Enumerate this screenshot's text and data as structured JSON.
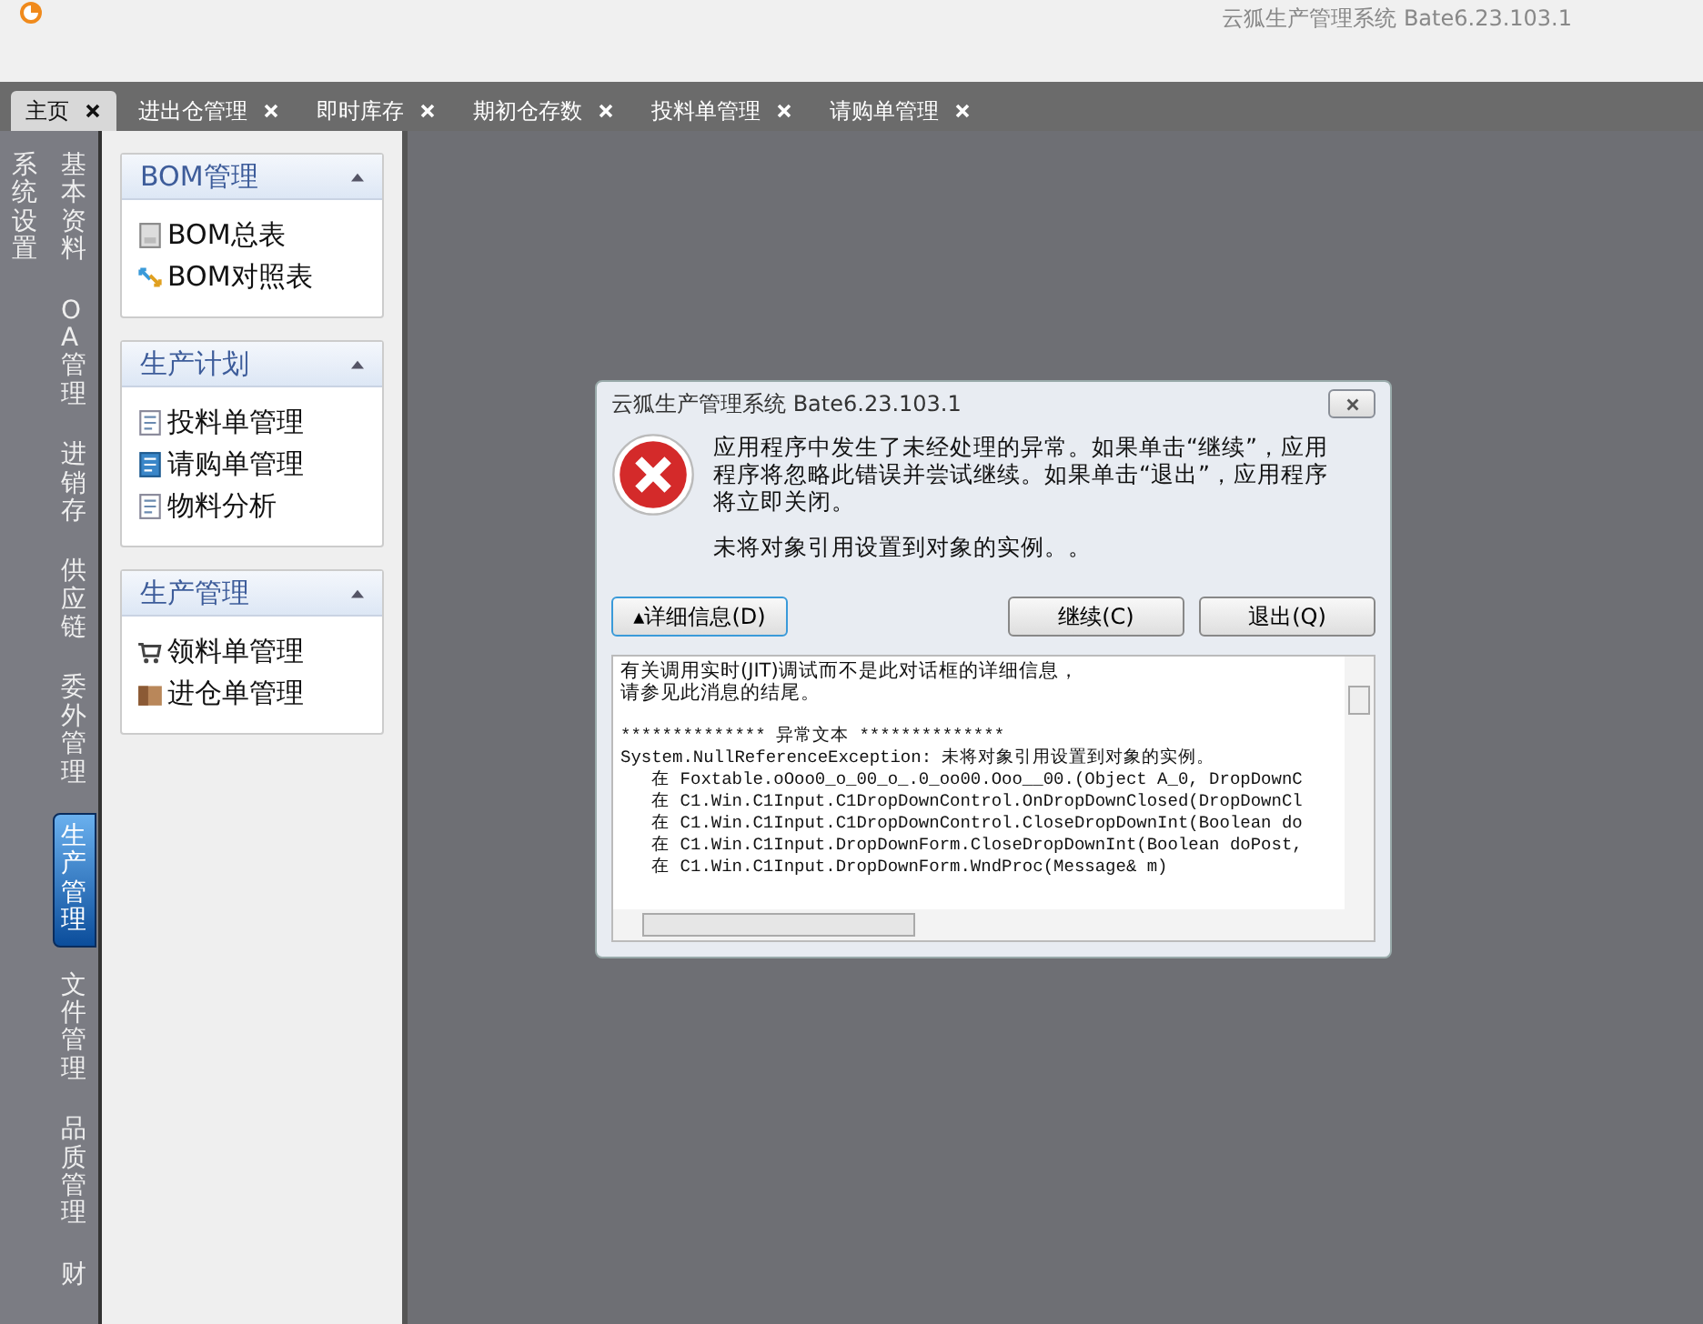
{
  "app_title": "云狐生产管理系统 Bate6.23.103.1",
  "tabs": [
    {
      "label": "主页",
      "selected": true
    },
    {
      "label": "进出仓管理",
      "selected": false
    },
    {
      "label": "即时库存",
      "selected": false
    },
    {
      "label": "期初仓存数",
      "selected": false
    },
    {
      "label": "投料单管理",
      "selected": false
    },
    {
      "label": "请购单管理",
      "selected": false
    }
  ],
  "nav_columns": [
    [
      {
        "label": "系统设置",
        "selected": false
      }
    ],
    [
      {
        "label": "基本资料",
        "selected": false
      },
      {
        "label": "OA管理",
        "selected": false
      },
      {
        "label": "进销存",
        "selected": false
      },
      {
        "label": "供应链",
        "selected": false
      },
      {
        "label": "委外管理",
        "selected": false
      },
      {
        "label": "生产管理",
        "selected": true
      },
      {
        "label": "文件管理",
        "selected": false
      },
      {
        "label": "品质管理",
        "selected": false
      },
      {
        "label": "财",
        "selected": false
      }
    ]
  ],
  "groups": [
    {
      "title": "BOM管理",
      "expanded": true,
      "items": [
        {
          "label": "BOM总表",
          "kind": "sheet"
        },
        {
          "label": "BOM对照表",
          "kind": "swap"
        }
      ]
    },
    {
      "title": "生产计划",
      "expanded": true,
      "items": [
        {
          "label": "投料单管理",
          "kind": "doc"
        },
        {
          "label": "请购单管理",
          "kind": "bluedoc"
        },
        {
          "label": "物料分析",
          "kind": "doc"
        }
      ]
    },
    {
      "title": "生产管理",
      "expanded": true,
      "items": [
        {
          "label": "领料单管理",
          "kind": "cart"
        },
        {
          "label": "进仓单管理",
          "kind": "box"
        }
      ]
    }
  ],
  "dialog": {
    "title": "云狐生产管理系统 Bate6.23.103.1",
    "message": "应用程序中发生了未经处理的异常。如果单击“继续”，应用程序将忽略此错误并尝试继续。如果单击“退出”，应用程序将立即关闭。",
    "detail_message": "未将对象引用设置到对象的实例。。",
    "details_button": "▴详细信息(D)",
    "buttons": [
      "继续(C)",
      "退出(Q)"
    ],
    "details": [
      {
        "kind": "note",
        "text": "有关调用实时(JIT)调试而不是此对话框的详细信息，"
      },
      {
        "kind": "note",
        "text": "请参见此消息的结尾。"
      },
      {
        "kind": "heading",
        "text": "************** 异常文本 **************"
      },
      {
        "kind": "trace",
        "text": "System.NullReferenceException: 未将对象引用设置到对象的实例。"
      },
      {
        "kind": "trace",
        "text": "   在 Foxtable.oOoo0_o_00_o_.0_oo00.Ooo__00.(Object A_0, DropDownC"
      },
      {
        "kind": "trace",
        "text": "   在 C1.Win.C1Input.C1DropDownControl.OnDropDownClosed(DropDownCl"
      },
      {
        "kind": "trace",
        "text": "   在 C1.Win.C1Input.C1DropDownControl.CloseDropDownInt(Boolean do"
      },
      {
        "kind": "trace",
        "text": "   在 C1.Win.C1Input.DropDownForm.CloseDropDownInt(Boolean doPost,"
      },
      {
        "kind": "trace",
        "text": "   在 C1.Win.C1Input.DropDownForm.WndProc(Message& m)"
      }
    ]
  }
}
